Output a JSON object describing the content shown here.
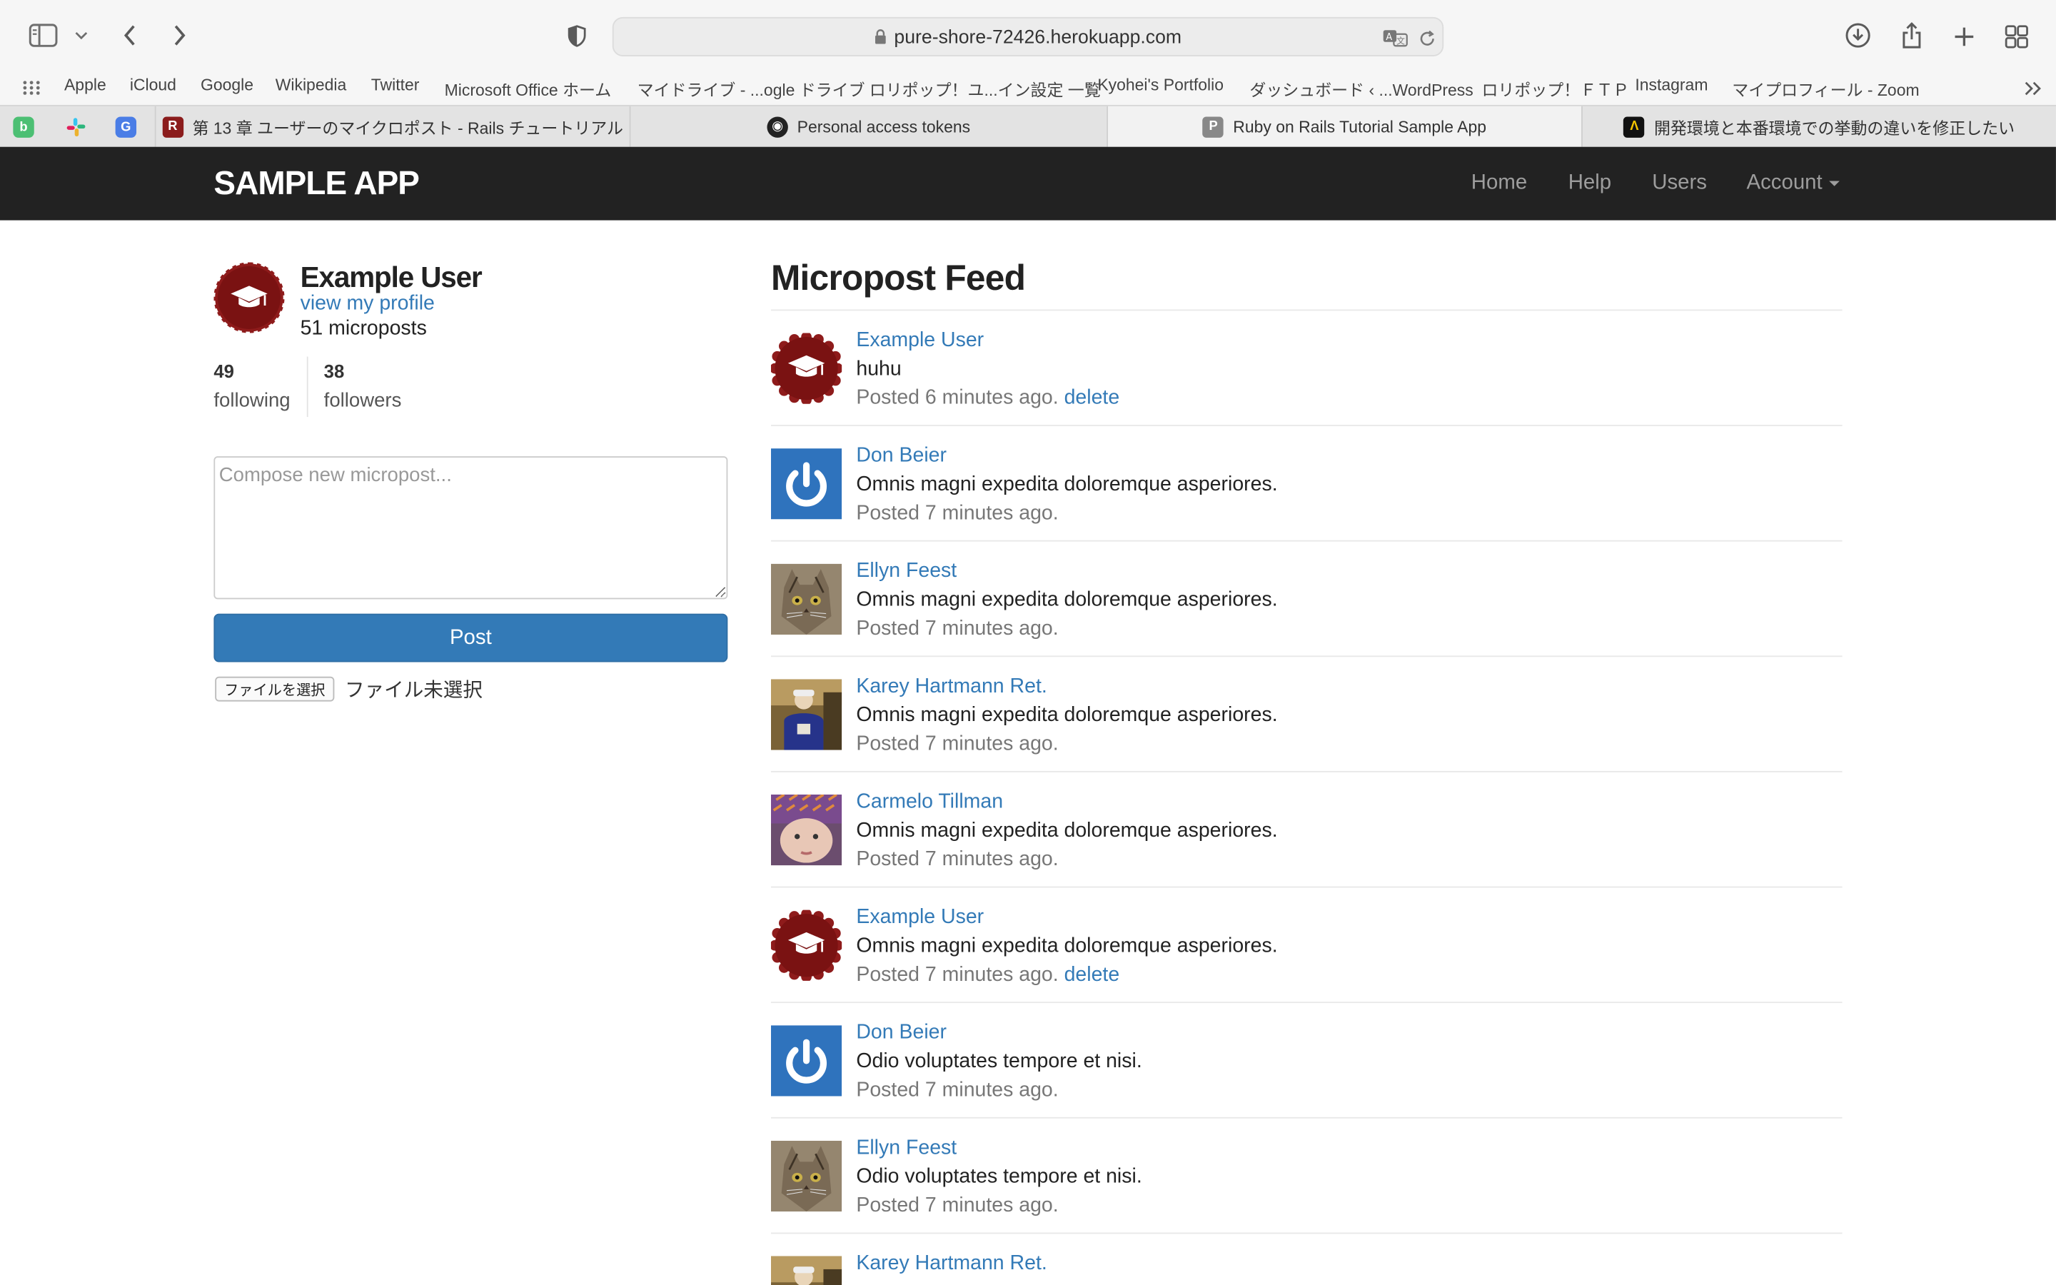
{
  "browser": {
    "url": "pure-shore-72426.herokuapp.com",
    "bookmarks": [
      "Apple",
      "iCloud",
      "Google",
      "Wikipedia",
      "Twitter",
      "Microsoft Office ホーム",
      "マイドライブ - ...ogle ドライブ",
      "ロリポップ！ユ...イン設定 一覧",
      "Kyohei's Portfolio",
      "ダッシュボード ‹ ...WordPress",
      "ロリポップ！ＦＴＰ",
      "Instagram",
      "マイプロフィール - Zoom"
    ],
    "tabs": [
      {
        "label": "第 13 章 ユーザーのマイクロポスト - Rails チュートリアル",
        "active": false
      },
      {
        "label": "Personal access tokens",
        "active": false
      },
      {
        "label": "Ruby on Rails Tutorial Sample App",
        "active": true
      },
      {
        "label": "開発環境と本番環境での挙動の違いを修正したい",
        "active": false
      }
    ]
  },
  "navbar": {
    "logo": "SAMPLE APP",
    "links": {
      "home": "Home",
      "help": "Help",
      "users": "Users",
      "account": "Account"
    }
  },
  "sidebar": {
    "user_name": "Example User",
    "profile_link": "view my profile",
    "micropost_count": "51 microposts",
    "following_count": "49",
    "following_label": "following",
    "followers_count": "38",
    "followers_label": "followers",
    "compose_placeholder": "Compose new micropost...",
    "post_button": "Post",
    "file_button": "ファイルを選択",
    "file_status": "ファイル未選択"
  },
  "feed": {
    "title": "Micropost Feed",
    "delete_label": "delete",
    "items": [
      {
        "user": "Example User",
        "content": "huhu",
        "time": "Posted 6 minutes ago.",
        "avatar": "badge",
        "deletable": true
      },
      {
        "user": "Don Beier",
        "content": "Omnis magni expedita doloremque asperiores.",
        "time": "Posted 7 minutes ago.",
        "avatar": "power",
        "deletable": false
      },
      {
        "user": "Ellyn Feest",
        "content": "Omnis magni expedita doloremque asperiores.",
        "time": "Posted 7 minutes ago.",
        "avatar": "cat",
        "deletable": false
      },
      {
        "user": "Karey Hartmann Ret.",
        "content": "Omnis magni expedita doloremque asperiores.",
        "time": "Posted 7 minutes ago.",
        "avatar": "person",
        "deletable": false
      },
      {
        "user": "Carmelo Tillman",
        "content": "Omnis magni expedita doloremque asperiores.",
        "time": "Posted 7 minutes ago.",
        "avatar": "baby",
        "deletable": false
      },
      {
        "user": "Example User",
        "content": "Omnis magni expedita doloremque asperiores.",
        "time": "Posted 7 minutes ago.",
        "avatar": "badge",
        "deletable": true
      },
      {
        "user": "Don Beier",
        "content": "Odio voluptates tempore et nisi.",
        "time": "Posted 7 minutes ago.",
        "avatar": "power",
        "deletable": false
      },
      {
        "user": "Ellyn Feest",
        "content": "Odio voluptates tempore et nisi.",
        "time": "Posted 7 minutes ago.",
        "avatar": "cat",
        "deletable": false
      },
      {
        "user": "Karey Hartmann Ret.",
        "content": "",
        "time": "",
        "avatar": "person",
        "deletable": false
      }
    ]
  },
  "colors": {
    "navbar": "#222222",
    "link": "#337ab7",
    "button": "#337ab7",
    "badge": "#7a1212"
  }
}
